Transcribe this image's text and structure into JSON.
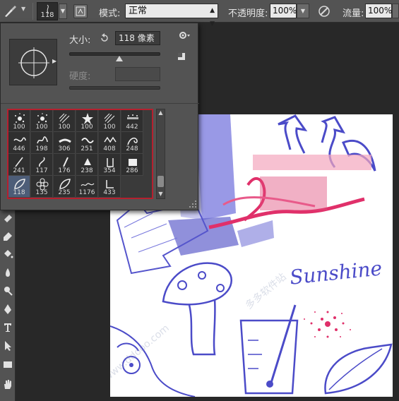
{
  "options_bar": {
    "brush_size": "118",
    "mode_label": "模式:",
    "mode_value": "正常",
    "opacity_label": "不透明度:",
    "opacity_value": "100%",
    "flow_label": "流量:",
    "flow_value": "100%"
  },
  "brush_picker": {
    "size_label": "大小:",
    "size_value": "118 像素",
    "size_slider_fraction": 0.55,
    "hardness_label": "硬度:",
    "presets": [
      {
        "size": "100",
        "icon": "splatter-brush-icon"
      },
      {
        "size": "100",
        "icon": "splatter-brush-icon"
      },
      {
        "size": "100",
        "icon": "hatch-brush-icon"
      },
      {
        "size": "100",
        "icon": "star-brush-icon"
      },
      {
        "size": "100",
        "icon": "hatch-brush-icon"
      },
      {
        "size": "442",
        "icon": "dots-brush-icon"
      },
      {
        "size": "446",
        "icon": "swirl-brush-icon"
      },
      {
        "size": "198",
        "icon": "scribble-brush-icon"
      },
      {
        "size": "306",
        "icon": "stroke-brush-icon"
      },
      {
        "size": "251",
        "icon": "wave-brush-icon"
      },
      {
        "size": "408",
        "icon": "zigzag-brush-icon"
      },
      {
        "size": "248",
        "icon": "flourish-brush-icon"
      },
      {
        "size": "241",
        "icon": "line-brush-icon"
      },
      {
        "size": "117",
        "icon": "curl-brush-icon"
      },
      {
        "size": "176",
        "icon": "pencil-brush-icon"
      },
      {
        "size": "238",
        "icon": "fill-brush-icon"
      },
      {
        "size": "354",
        "icon": "beaker-brush-icon"
      },
      {
        "size": "286",
        "icon": "block-brush-icon"
      },
      {
        "size": "118",
        "icon": "leaf-brush-icon"
      },
      {
        "size": "135",
        "icon": "flower-brush-icon"
      },
      {
        "size": "235",
        "icon": "leaf-brush-icon"
      },
      {
        "size": "1176",
        "icon": "word-brush-icon"
      },
      {
        "size": "433",
        "icon": "cup-brush-icon"
      }
    ],
    "selected_index": 18
  },
  "canvas": {
    "text": "Sunshine",
    "watermarks": [
      "多多软件站",
      "www.ddooo.com"
    ]
  },
  "colors": {
    "ink_blue": "#4f4fd0",
    "ink_pink": "#e0306a",
    "selection_frame": "#b5202f",
    "panel": "#535353"
  }
}
